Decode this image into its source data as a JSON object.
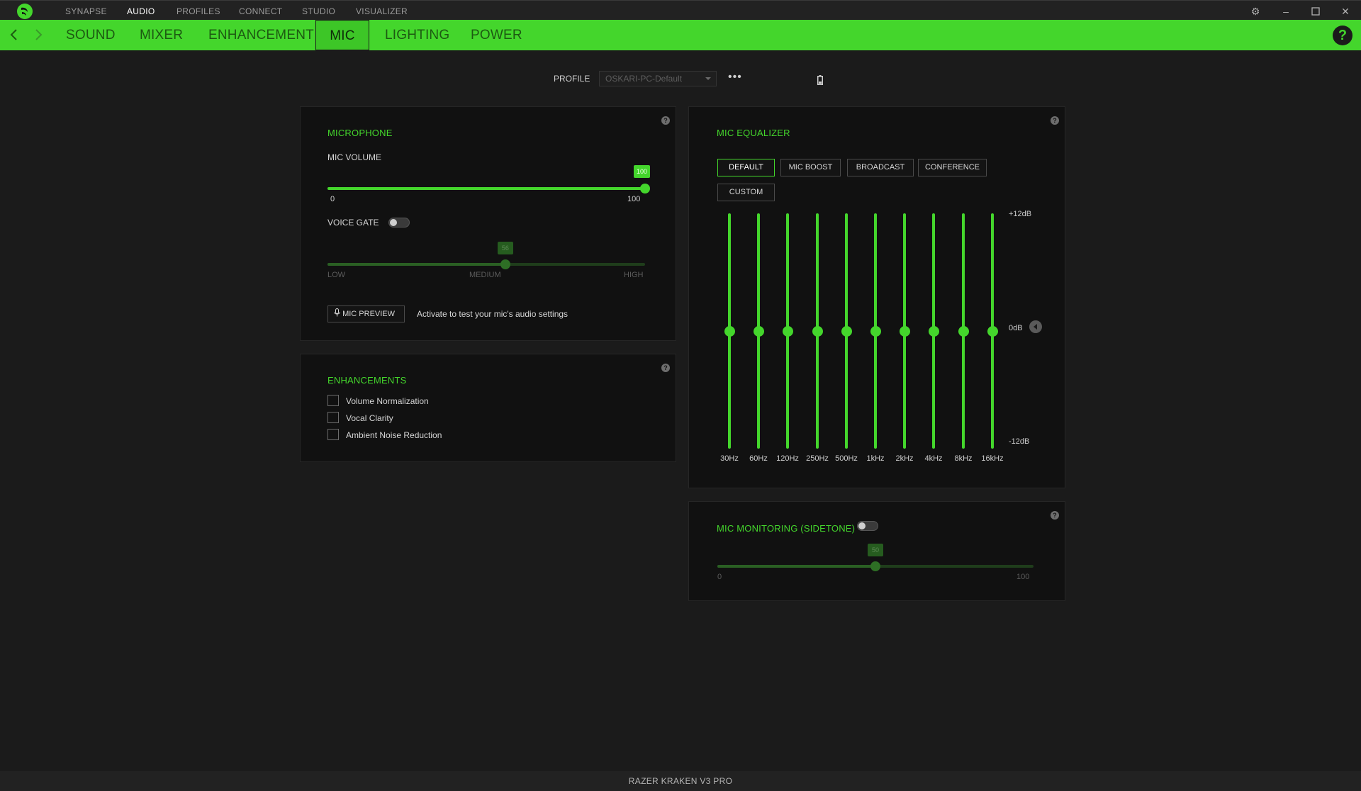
{
  "titlebar": {
    "tabs": [
      "SYNAPSE",
      "AUDIO",
      "PROFILES",
      "CONNECT",
      "STUDIO",
      "VISUALIZER"
    ],
    "active_tab": "AUDIO"
  },
  "subnav": {
    "tabs": [
      "SOUND",
      "MIXER",
      "ENHANCEMENT",
      "MIC",
      "LIGHTING",
      "POWER"
    ],
    "active_tab": "MIC",
    "help": "?"
  },
  "profile": {
    "label": "PROFILE",
    "value": "OSKARI-PC-Default",
    "more": "•••"
  },
  "microphone": {
    "title": "MICROPHONE",
    "mic_volume_label": "MIC VOLUME",
    "mic_volume": 100,
    "mic_volume_display": "100",
    "min_label": "0",
    "max_label": "100",
    "voice_gate_label": "VOICE GATE",
    "voice_gate_on": false,
    "voice_gate_value": 56,
    "voice_gate_display": "56",
    "gate_low": "LOW",
    "gate_medium": "MEDIUM",
    "gate_high": "HIGH",
    "preview_button": "MIC PREVIEW",
    "preview_hint": "Activate to test your mic's audio settings"
  },
  "enhancements": {
    "title": "ENHANCEMENTS",
    "items": [
      {
        "label": "Volume Normalization",
        "checked": false
      },
      {
        "label": "Vocal Clarity",
        "checked": false
      },
      {
        "label": "Ambient Noise Reduction",
        "checked": false
      }
    ]
  },
  "equalizer": {
    "title": "MIC EQUALIZER",
    "presets": [
      "DEFAULT",
      "MIC BOOST",
      "BROADCAST",
      "CONFERENCE",
      "CUSTOM"
    ],
    "selected_preset": "DEFAULT",
    "max_label": "+12dB",
    "mid_label": "0dB",
    "min_label": "-12dB",
    "bands": [
      {
        "label": "30Hz",
        "gain_db": 0
      },
      {
        "label": "60Hz",
        "gain_db": 0
      },
      {
        "label": "120Hz",
        "gain_db": 0
      },
      {
        "label": "250Hz",
        "gain_db": 0
      },
      {
        "label": "500Hz",
        "gain_db": 0
      },
      {
        "label": "1kHz",
        "gain_db": 0
      },
      {
        "label": "2kHz",
        "gain_db": 0
      },
      {
        "label": "4kHz",
        "gain_db": 0
      },
      {
        "label": "8kHz",
        "gain_db": 0
      },
      {
        "label": "16kHz",
        "gain_db": 0
      }
    ]
  },
  "monitoring": {
    "title": "MIC MONITORING (SIDETONE)",
    "enabled": false,
    "value": 50,
    "value_display": "50",
    "min_label": "0",
    "max_label": "100"
  },
  "footer": {
    "device": "RAZER KRAKEN V3 PRO"
  }
}
